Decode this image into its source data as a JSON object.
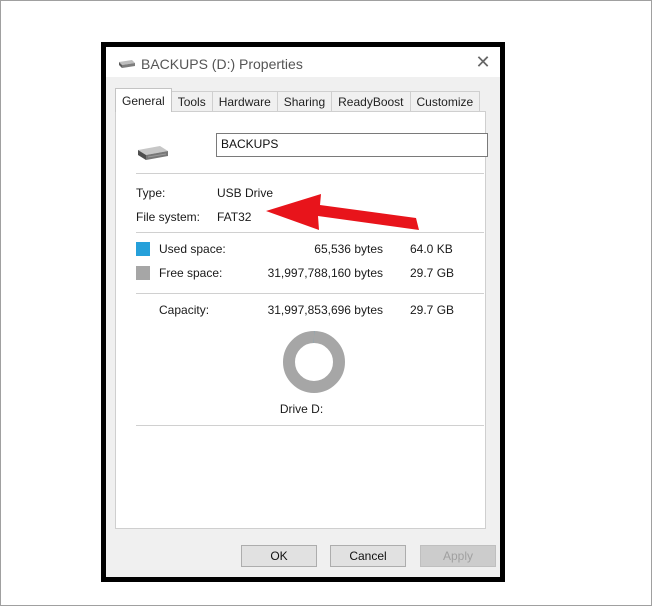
{
  "window": {
    "title": "BACKUPS (D:) Properties",
    "close_glyph": "✕"
  },
  "tabs": [
    {
      "label": "General",
      "active": true
    },
    {
      "label": "Tools"
    },
    {
      "label": "Hardware"
    },
    {
      "label": "Sharing"
    },
    {
      "label": "ReadyBoost"
    },
    {
      "label": "Customize"
    }
  ],
  "general": {
    "volume_name": "BACKUPS",
    "type_label": "Type:",
    "type_value": "USB Drive",
    "fs_label": "File system:",
    "fs_value": "FAT32",
    "used_label": "Used space:",
    "used_bytes": "65,536 bytes",
    "used_size": "64.0 KB",
    "free_label": "Free space:",
    "free_bytes": "31,997,788,160 bytes",
    "free_size": "29.7 GB",
    "capacity_label": "Capacity:",
    "capacity_bytes": "31,997,853,696 bytes",
    "capacity_size": "29.7 GB",
    "drive_label": "Drive D:",
    "used_fraction": 2e-06
  },
  "buttons": {
    "ok": "OK",
    "cancel": "Cancel",
    "apply": "Apply"
  },
  "colors": {
    "used": "#26a0da",
    "free": "#a6a6a6",
    "arrow": "#e8141b"
  }
}
